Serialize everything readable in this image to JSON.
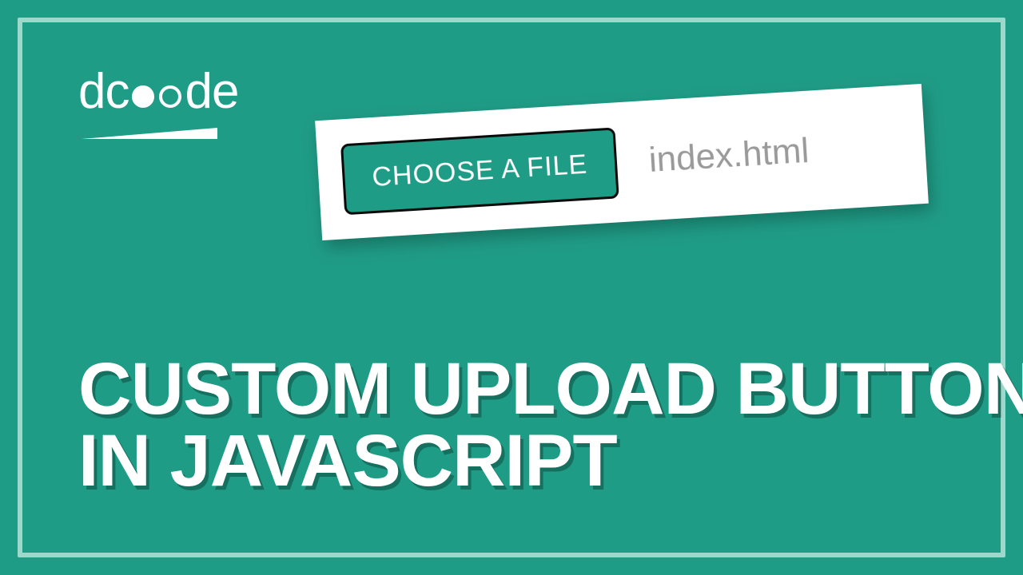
{
  "logo": {
    "text_prefix": "dc",
    "text_suffix": "de"
  },
  "card": {
    "button_label": "CHOOSE A FILE",
    "filename": "index.html"
  },
  "headline": {
    "line1": "CUSTOM UPLOAD BUTTON",
    "line2": "IN JAVASCRIPT"
  },
  "colors": {
    "background": "#1f9c86",
    "border": "#9cd9cc",
    "text": "#ffffff",
    "filename": "#9a9a9a"
  }
}
